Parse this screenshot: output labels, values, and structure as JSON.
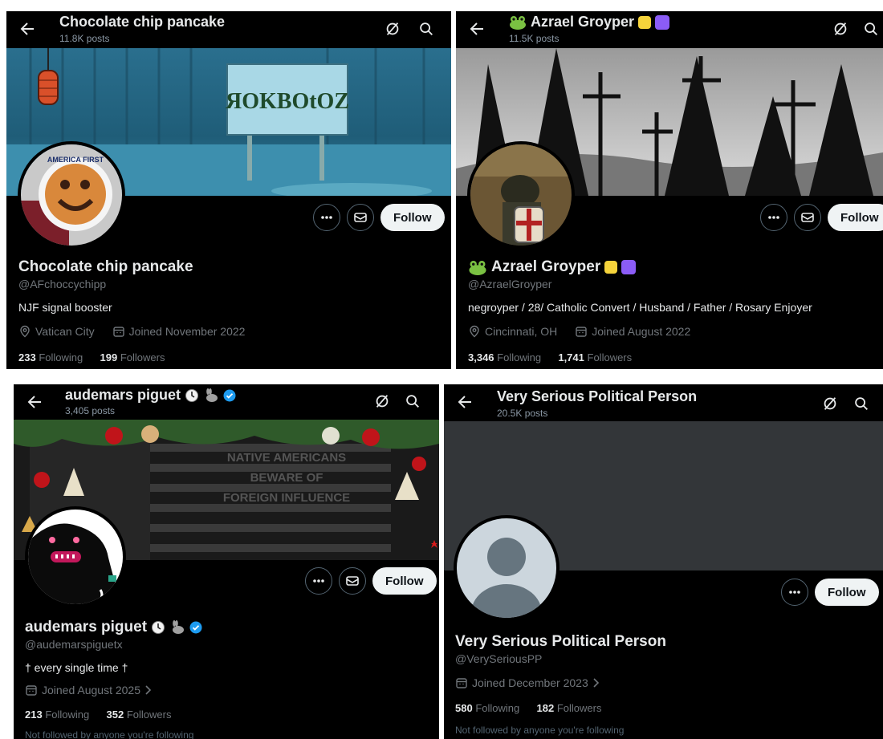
{
  "panels": [
    {
      "title": "Chocolate chip pancake",
      "posts": "11.8K posts",
      "name": "Chocolate chip pancake",
      "handle": "@AFchoccychipp",
      "bio": "NJF signal booster",
      "location": "Vatican City",
      "joined": "Joined November 2022",
      "following_count": "233",
      "following_label": "Following",
      "followers_count": "199",
      "followers_label": "Followers",
      "follow_label": "Follow",
      "banner_sign": "ЯOKBOtOZ",
      "avatar_text": "AMERICA FIRST"
    },
    {
      "title": "Azrael Groyper",
      "posts": "11.5K posts",
      "name": "Azrael Groyper",
      "handle": "@AzraelGroyper",
      "bio": "negroyper / 28/ Catholic Convert / Husband / Father / Rosary Enjoyer",
      "location": "Cincinnati, OH",
      "joined": "Joined August 2022",
      "following_count": "3,346",
      "following_label": "Following",
      "followers_count": "1,741",
      "followers_label": "Followers",
      "follow_label": "Follow"
    },
    {
      "title": "audemars piguet",
      "posts": "3,405 posts",
      "name": "audemars piguet",
      "handle": "@audemarspiguetx",
      "bio": "† every single time †",
      "joined": "Joined August 2025",
      "following_count": "213",
      "following_label": "Following",
      "followers_count": "352",
      "followers_label": "Followers",
      "not_followed": "Not followed by anyone you're following",
      "follow_label": "Follow",
      "banner_lines": [
        "NATIVE AMERICANS",
        "BEWARE OF",
        "FOREIGN INFLUENCE"
      ]
    },
    {
      "title": "Very Serious Political Person",
      "posts": "20.5K posts",
      "name": "Very Serious Political Person",
      "handle": "@VerySeriousPP",
      "joined": "Joined December 2023",
      "following_count": "580",
      "following_label": "Following",
      "followers_count": "182",
      "followers_label": "Followers",
      "not_followed": "Not followed by anyone you're following",
      "follow_label": "Follow"
    }
  ],
  "colors": {
    "background": "#000000",
    "text": "#e7e9ea",
    "muted": "#71767b",
    "follow_bg": "#eff3f4",
    "verified": "#1d9bf0",
    "placeholder_banner": "#333639"
  }
}
